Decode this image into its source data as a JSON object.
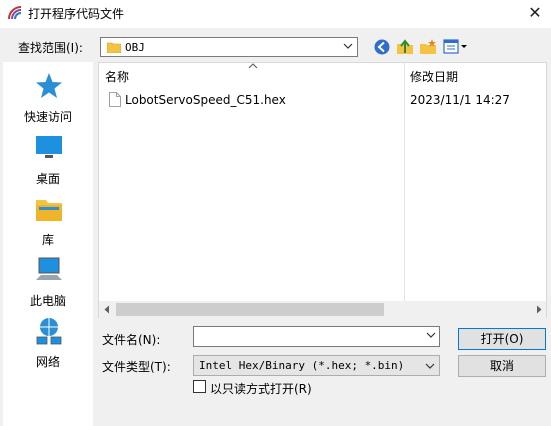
{
  "window": {
    "title": "打开程序代码文件",
    "close_glyph": "✕"
  },
  "lookin": {
    "label": "查找范围(I):",
    "value": "OBJ"
  },
  "places": [
    {
      "label": "快速访问",
      "icon": "star-icon"
    },
    {
      "label": "桌面",
      "icon": "desktop-icon"
    },
    {
      "label": "库",
      "icon": "library-icon"
    },
    {
      "label": "此电脑",
      "icon": "computer-icon"
    },
    {
      "label": "网络",
      "icon": "network-icon"
    }
  ],
  "list": {
    "columns": [
      "名称",
      "修改日期"
    ],
    "rows": [
      {
        "name": "LobotServoSpeed_C51.hex",
        "date": "2023/11/1 14:27"
      }
    ]
  },
  "file_name": {
    "label": "文件名(N):",
    "value": ""
  },
  "file_type": {
    "label": "文件类型(T):",
    "value": "Intel Hex/Binary (*.hex; *.bin)"
  },
  "buttons": {
    "open": "打开(O)",
    "cancel": "取消"
  },
  "read_only": {
    "label": "以只读方式打开(R)",
    "checked": false
  },
  "colors": {
    "accent": "#0078d7",
    "folder": "#f5c342"
  }
}
